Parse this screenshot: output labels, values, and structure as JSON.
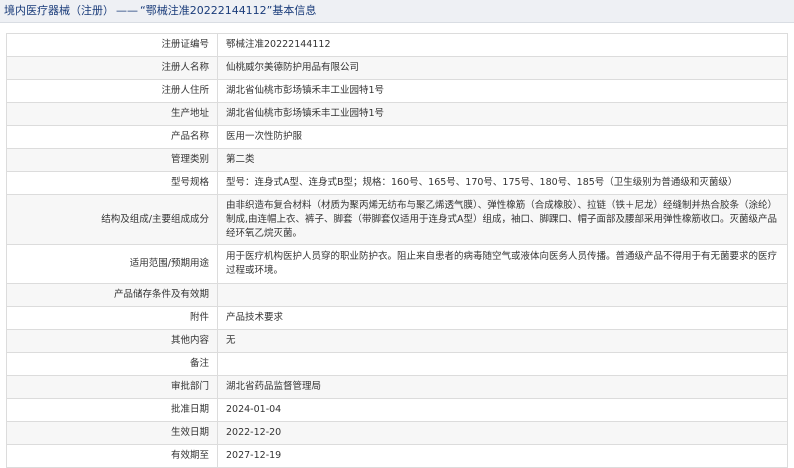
{
  "header": {
    "category": "境内医疗器械（注册）",
    "separator": "——",
    "record": "“鄂械注准20222144112”基本信息"
  },
  "rows": [
    {
      "label": "注册证编号",
      "value": "鄂械注准20222144112"
    },
    {
      "label": "注册人名称",
      "value": "仙桃威尔美德防护用品有限公司"
    },
    {
      "label": "注册人住所",
      "value": "湖北省仙桃市彭场镇禾丰工业园特1号"
    },
    {
      "label": "生产地址",
      "value": "湖北省仙桃市彭场镇禾丰工业园特1号"
    },
    {
      "label": "产品名称",
      "value": "医用一次性防护服"
    },
    {
      "label": "管理类别",
      "value": "第二类"
    },
    {
      "label": "型号规格",
      "value": "型号：连身式A型、连身式B型；规格：160号、165号、170号、175号、180号、185号（卫生级别为普通级和灭菌级）"
    },
    {
      "label": "结构及组成/主要组成成分",
      "value": "由非织造布复合材料（材质为聚丙烯无纺布与聚乙烯透气膜）、弹性橡筋（合成橡胶）、拉链（铁＋尼龙）经缝制并热合胶条（涂纶）制成,由连帽上衣、裤子、脚套（带脚套仅适用于连身式A型）组成，袖口、脚踝口、帽子面部及腰部采用弹性橡筋收口。灭菌级产品经环氧乙烷灭菌。"
    },
    {
      "label": "适用范围/预期用途",
      "value": "用于医疗机构医护人员穿的职业防护衣。阻止来自患者的病毒随空气或液体向医务人员传播。普通级产品不得用于有无菌要求的医疗过程或环境。"
    },
    {
      "label": "产品储存条件及有效期",
      "value": ""
    },
    {
      "label": "附件",
      "value": "产品技术要求"
    },
    {
      "label": "其他内容",
      "value": "无"
    },
    {
      "label": "备注",
      "value": ""
    },
    {
      "label": "审批部门",
      "value": "湖北省药品监督管理局"
    },
    {
      "label": "批准日期",
      "value": "2024-01-04"
    },
    {
      "label": "生效日期",
      "value": "2022-12-20"
    },
    {
      "label": "有效期至",
      "value": "2027-12-19"
    }
  ]
}
